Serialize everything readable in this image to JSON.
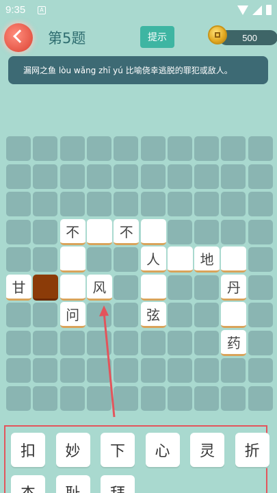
{
  "status": {
    "time": "9:35",
    "notice_icon": "A"
  },
  "header": {
    "level_title": "第5题",
    "hint_label": "提示",
    "coins": "500"
  },
  "clue": {
    "text": "漏网之鱼  lòu wǎng zhī yú  比喻侥幸逃脱的罪犯或敌人。"
  },
  "board": {
    "rows": 10,
    "cols": 10,
    "tiles": [
      {
        "r": 3,
        "c": 2,
        "char": "不"
      },
      {
        "r": 3,
        "c": 3,
        "char": ""
      },
      {
        "r": 3,
        "c": 4,
        "char": "不"
      },
      {
        "r": 3,
        "c": 5,
        "char": ""
      },
      {
        "r": 4,
        "c": 2,
        "char": ""
      },
      {
        "r": 4,
        "c": 5,
        "char": "人"
      },
      {
        "r": 4,
        "c": 6,
        "char": ""
      },
      {
        "r": 4,
        "c": 7,
        "char": "地"
      },
      {
        "r": 4,
        "c": 8,
        "char": ""
      },
      {
        "r": 5,
        "c": 0,
        "char": "甘"
      },
      {
        "r": 5,
        "c": 1,
        "char": "",
        "selected": true
      },
      {
        "r": 5,
        "c": 2,
        "char": ""
      },
      {
        "r": 5,
        "c": 3,
        "char": "风"
      },
      {
        "r": 5,
        "c": 5,
        "char": ""
      },
      {
        "r": 5,
        "c": 8,
        "char": "丹"
      },
      {
        "r": 6,
        "c": 2,
        "char": "问"
      },
      {
        "r": 6,
        "c": 5,
        "char": "弦"
      },
      {
        "r": 6,
        "c": 8,
        "char": ""
      },
      {
        "r": 7,
        "c": 8,
        "char": "药"
      }
    ]
  },
  "choices": [
    "扣",
    "妙",
    "下",
    "心",
    "灵",
    "折",
    "杰",
    "耻",
    "拜"
  ],
  "colors": {
    "background": "#a9d9cf",
    "selected_tile": "#8b3b08",
    "hint_button": "#3eb5a2",
    "annotation": "#e3545b"
  }
}
